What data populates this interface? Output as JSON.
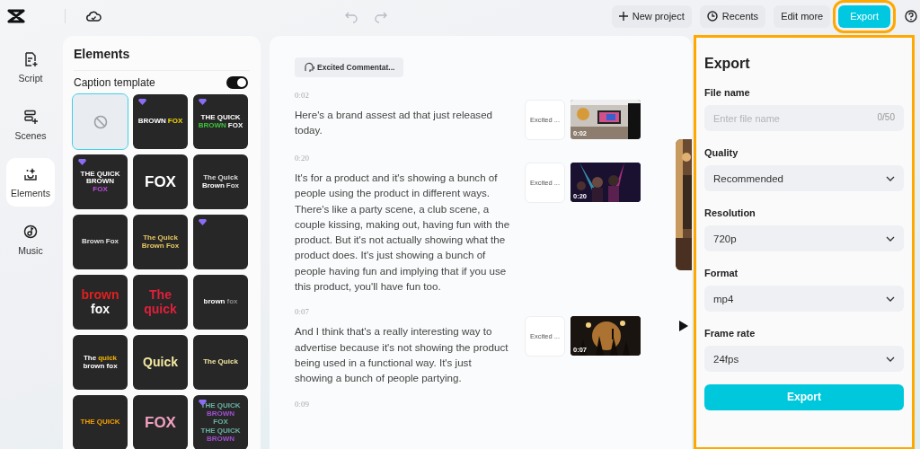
{
  "topbar": {
    "history": [
      {
        "kind": "undo",
        "disabled": true
      },
      {
        "kind": "redo",
        "disabled": true
      }
    ],
    "buttons": [
      {
        "kind": "new",
        "label": "New project",
        "highlighted": false
      },
      {
        "kind": "recents",
        "label": "Recents",
        "highlighted": false
      },
      {
        "kind": "plain",
        "label": "Edit more",
        "highlighted": false
      },
      {
        "kind": "primary",
        "label": "Export",
        "highlighted": true
      }
    ]
  },
  "sidebar": {
    "items": [
      {
        "kind": "script",
        "label": "Script",
        "selected": false
      },
      {
        "kind": "scenes",
        "label": "Scenes",
        "selected": false
      },
      {
        "kind": "elements",
        "label": "Elements",
        "selected": true
      },
      {
        "kind": "music",
        "label": "Music",
        "selected": false
      }
    ]
  },
  "elements_panel": {
    "title": "Elements",
    "caption_template": {
      "label": "Caption template",
      "on": true
    },
    "templates": [
      {
        "kind": "none",
        "premium": false,
        "selected": true
      },
      {
        "kind": "caption",
        "premium": true,
        "selected": false,
        "lines": [
          [
            {
              "text": "BROWN",
              "color": "#ffffff"
            },
            {
              "text": "FOX",
              "color": "#f5d90a"
            }
          ]
        ]
      },
      {
        "kind": "caption",
        "premium": true,
        "selected": false,
        "lines": [
          [
            {
              "text": "THE QUICK",
              "color": "#ffffff"
            },
            {
              "text": "BROWN",
              "color": "#3ac43a"
            },
            {
              "text": "FOX",
              "color": "#ffffff"
            }
          ]
        ]
      },
      {
        "kind": "caption",
        "premium": true,
        "selected": false,
        "lines": [
          [
            {
              "text": "THE QUICK BROWN",
              "color": "#ffffff"
            },
            {
              "text": "FOX",
              "color": "#c04ce0"
            }
          ]
        ]
      },
      {
        "kind": "caption",
        "premium": false,
        "selected": false,
        "lines": [
          [
            {
              "text": "FOX",
              "color": "#ffffff"
            }
          ]
        ]
      },
      {
        "kind": "caption",
        "premium": false,
        "selected": false,
        "lines": [
          [
            {
              "text": "The Quick",
              "color": "#dddddd"
            },
            {
              "text": "Brown",
              "color": "#ffffff"
            },
            {
              "text": "Fox",
              "color": "#dddddd"
            }
          ]
        ]
      },
      {
        "kind": "caption",
        "premium": false,
        "selected": false,
        "lines": [
          [
            {
              "text": "Brown",
              "color": "#e0e0e0"
            },
            {
              "text": "Fox",
              "color": "#e0e0e0"
            }
          ]
        ]
      },
      {
        "kind": "caption",
        "premium": false,
        "selected": false,
        "lines": [
          [
            {
              "text": "The Quick Brown Fox",
              "color": "#e8c860"
            }
          ]
        ]
      },
      {
        "kind": "blank",
        "premium": true,
        "selected": false
      },
      {
        "kind": "caption",
        "premium": false,
        "selected": false,
        "lines": [
          [
            {
              "text": "brown",
              "color": "#e02020"
            }
          ],
          [
            {
              "text": "fox",
              "color": "#ffffff"
            }
          ]
        ]
      },
      {
        "kind": "caption",
        "premium": false,
        "selected": false,
        "lines": [
          [
            {
              "text": "The",
              "color": "#e0203a"
            }
          ],
          [
            {
              "text": "quick",
              "color": "#e0203a"
            }
          ]
        ]
      },
      {
        "kind": "caption",
        "premium": false,
        "selected": false,
        "lines": [
          [
            {
              "text": "brown",
              "color": "#ffffff"
            },
            {
              "text": "fox",
              "color": "#8a8a8a"
            }
          ]
        ]
      },
      {
        "kind": "caption",
        "premium": false,
        "selected": false,
        "lines": [
          [
            {
              "text": "The",
              "color": "#ffffff"
            },
            {
              "text": "quick",
              "color": "#f5b800"
            }
          ],
          [
            {
              "text": "brown fox",
              "color": "#ffffff"
            }
          ]
        ]
      },
      {
        "kind": "caption",
        "premium": false,
        "selected": false,
        "lines": [
          [
            {
              "text": "Quick",
              "color": "#f3e8a0"
            }
          ]
        ]
      },
      {
        "kind": "caption",
        "premium": false,
        "selected": false,
        "lines": [
          [
            {
              "text": "The Quick",
              "color": "#f3e8a0"
            }
          ]
        ]
      },
      {
        "kind": "caption",
        "premium": false,
        "selected": false,
        "lines": [
          [
            {
              "text": "THE QUICK",
              "color": "#f5a000"
            }
          ]
        ]
      },
      {
        "kind": "caption",
        "premium": false,
        "selected": false,
        "lines": [
          [
            {
              "text": "FOX",
              "color": "#f0a0c0"
            }
          ]
        ]
      },
      {
        "kind": "caption",
        "premium": true,
        "selected": false,
        "lines": [
          [
            {
              "text": "THE QUICK",
              "color": "#6ab0a0"
            }
          ],
          [
            {
              "text": "BROWN",
              "color": "#a050d0"
            }
          ],
          [
            {
              "text": "FOX",
              "color": "#6ab0a0"
            }
          ],
          [
            {
              "text": "THE QUICK",
              "color": "#6ab0a0"
            }
          ],
          [
            {
              "text": "BROWN",
              "color": "#a050d0"
            }
          ]
        ]
      }
    ]
  },
  "script": {
    "voice": "Excited Commentat...",
    "entries": [
      {
        "time": "0:02",
        "text": "Here's a brand assest ad that just released today.",
        "voice": "Excited ...",
        "clip_time": "0:02"
      },
      {
        "time": "0:20",
        "text": "It's for a product and it's showing a bunch of people using the product in different ways. There's like a party scene, a club scene, a couple kissing, making out, having fun with the product. But it's not actually showing what the product does. It's just showing a bunch of people having fun and implying that if you use this product, you'll have fun too.",
        "voice": "Excited ...",
        "clip_time": "0:20"
      },
      {
        "time": "0:07",
        "text": "And I think that's a really interesting way to advertise because it's not showing the product being used in a functional way. It's just showing a bunch of people partying.",
        "voice": "Excited ...",
        "clip_time": "0:07"
      },
      {
        "time": "0:09"
      }
    ]
  },
  "export_panel": {
    "highlighted": true,
    "title": "Export",
    "fields": [
      {
        "kind": "text",
        "label": "File name",
        "placeholder": "Enter file name",
        "counter": "0/50"
      },
      {
        "kind": "select",
        "label": "Quality",
        "value": "Recommended"
      },
      {
        "kind": "select",
        "label": "Resolution",
        "value": "720p"
      },
      {
        "kind": "select",
        "label": "Format",
        "value": "mp4"
      },
      {
        "kind": "select",
        "label": "Frame rate",
        "value": "24fps"
      }
    ],
    "button": "Export"
  }
}
